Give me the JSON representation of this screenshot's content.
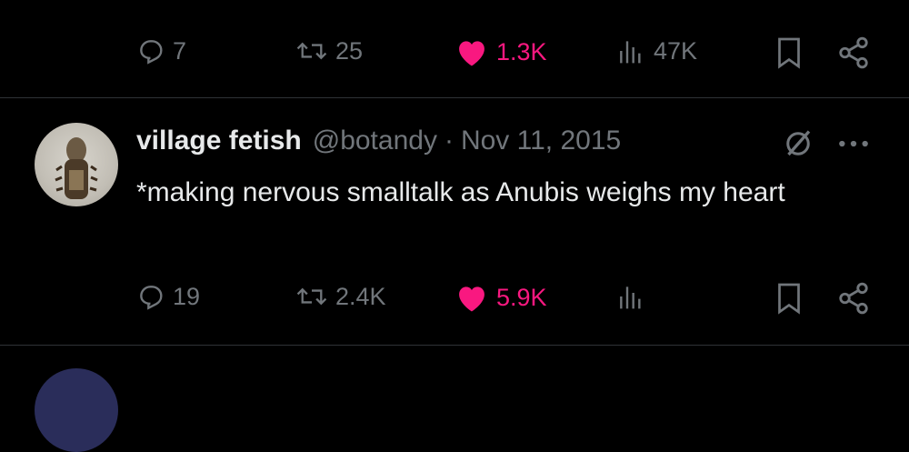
{
  "top_tweet": {
    "replies": "7",
    "retweets": "25",
    "likes": "1.3K",
    "views": "47K"
  },
  "tweet": {
    "display_name": "village fetish",
    "handle": "@botandy",
    "separator": "·",
    "date": "Nov 11, 2015",
    "text": "*making nervous smalltalk as Anubis weighs my heart",
    "replies": "19",
    "retweets": "2.4K",
    "likes": "5.9K"
  },
  "colors": {
    "like": "#f91880",
    "muted": "#71767b",
    "text": "#e7e9ea",
    "divider": "#2f3336"
  },
  "icons": [
    "reply-icon",
    "retweet-icon",
    "heart-icon",
    "views-icon",
    "bookmark-icon",
    "share-icon",
    "grok-icon",
    "more-icon"
  ]
}
